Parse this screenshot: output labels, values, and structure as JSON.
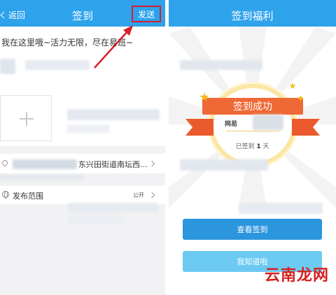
{
  "left_screen": {
    "nav": {
      "back_label": "返回",
      "title": "签到",
      "send_label": "发送"
    },
    "post_text": "我在这里哦~活力无限，尽在易班~",
    "location_text": "东兴田街道南坛西...",
    "scope": {
      "label": "发布范围",
      "value": "公开"
    },
    "colors": {
      "nav": "#2ea3ec",
      "highlight_border": "#d4202c"
    }
  },
  "right_screen": {
    "nav": {
      "title": "签到福利"
    },
    "badge": {
      "title": "签到成功",
      "name_partial": "网易",
      "days_prefix": "已签到",
      "days_count": "1",
      "days_suffix": "天"
    },
    "buttons": {
      "primary": "查看签到",
      "secondary": "我知道啦"
    },
    "colors": {
      "primary_button": "#2b95de",
      "secondary_button": "#6ccaf2",
      "ribbon": "#ef6936"
    }
  },
  "watermark": "云南龙网"
}
